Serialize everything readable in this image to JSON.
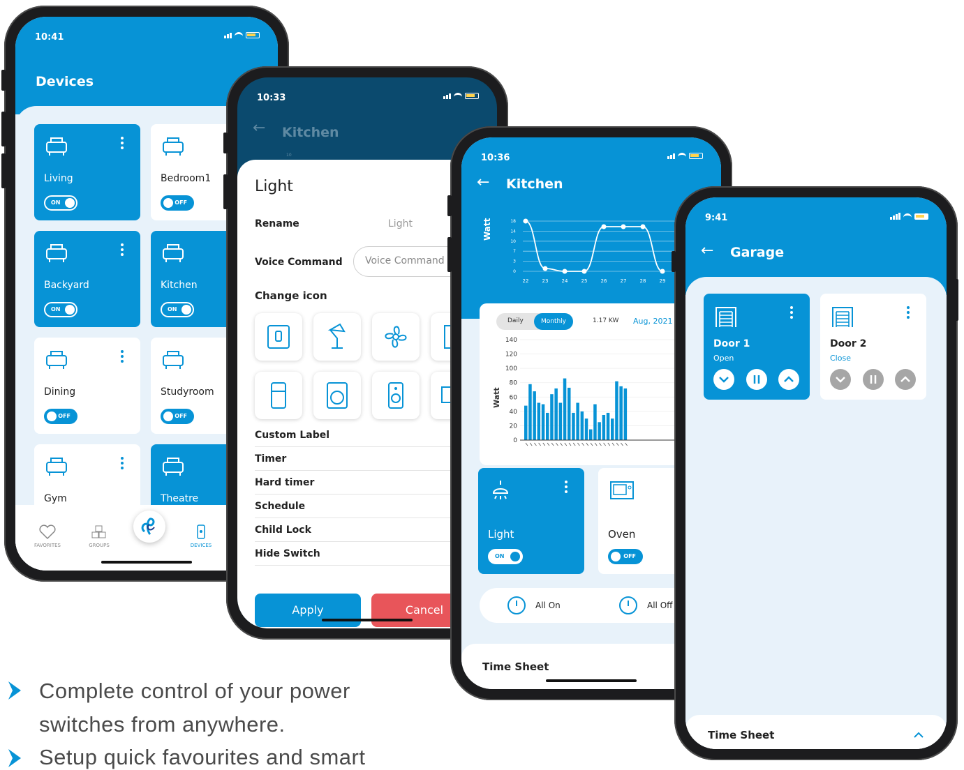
{
  "phone1": {
    "time": "10:41",
    "title": "Devices",
    "rooms": [
      {
        "name": "Living",
        "state": "ON",
        "icon": "sofa-icon"
      },
      {
        "name": "Bedroom1",
        "state": "OFF",
        "icon": "bed-icon"
      },
      {
        "name": "Backyard",
        "state": "ON",
        "icon": "house-icon"
      },
      {
        "name": "Kitchen",
        "state": "ON",
        "icon": "chef-hat-icon"
      },
      {
        "name": "Dining",
        "state": "OFF",
        "icon": "dining-table-icon"
      },
      {
        "name": "Studyroom",
        "state": "OFF",
        "icon": "desk-icon"
      },
      {
        "name": "Gym",
        "state": "",
        "icon": "exercise-bike-icon"
      },
      {
        "name": "Theatre",
        "state": "",
        "icon": "projector-icon"
      }
    ],
    "nav": {
      "favorites": "FAVORITES",
      "groups": "GROUPS",
      "devices": "DEVICES"
    }
  },
  "phone2": {
    "time": "10:33",
    "header": "Kitchen",
    "chart_tick": "10",
    "sheet_title": "Light",
    "rename_label": "Rename",
    "rename_value": "Light",
    "voice_label": "Voice Command",
    "voice_placeholder": "Voice Command",
    "change_icon": "Change icon",
    "rows": [
      "Custom Label",
      "Timer",
      "Hard timer",
      "Schedule",
      "Child Lock",
      "Hide Switch"
    ],
    "apply": "Apply",
    "cancel": "Cancel"
  },
  "phone3": {
    "time": "10:36",
    "header": "Kitchen",
    "line_ylabel": "Watt",
    "bar_ylabel": "Watt",
    "tab_daily": "Daily",
    "tab_monthly": "Monthly",
    "kw": "1.17 KW",
    "month": "Aug, 2021",
    "light": {
      "name": "Light",
      "state": "ON"
    },
    "oven": {
      "name": "Oven",
      "state": "OFF"
    },
    "all_on": "All On",
    "all_off": "All Off",
    "timesheet": "Time Sheet"
  },
  "phone4": {
    "time": "9:41",
    "header": "Garage",
    "door1": {
      "name": "Door 1",
      "status": "Open"
    },
    "door2": {
      "name": "Door 2",
      "status": "Close"
    },
    "timesheet": "Time Sheet"
  },
  "bullets": [
    "Complete control of your power",
    "switches from anywhere.",
    "Setup quick favourites and smart"
  ],
  "colors": {
    "primary": "#0793d6",
    "cancel": "#e8555a",
    "dark_header": "#0b4a6e"
  },
  "chart_data": [
    {
      "type": "line",
      "ylabel": "Watt",
      "x": [
        "22",
        "23",
        "24",
        "25",
        "26",
        "27",
        "28",
        "29"
      ],
      "yticks": [
        "18",
        "14",
        "10",
        "7",
        "3",
        "0"
      ],
      "values": [
        18,
        1,
        0,
        0,
        16,
        16,
        16,
        0
      ]
    },
    {
      "type": "bar",
      "ylabel": "Watt",
      "yticks": [
        "140",
        "120",
        "100",
        "80",
        "60",
        "40",
        "20",
        "0"
      ],
      "ylim": [
        0,
        140
      ],
      "values": [
        48,
        78,
        68,
        52,
        50,
        38,
        64,
        72,
        52,
        86,
        73,
        38,
        52,
        40,
        30,
        15,
        50,
        25,
        35,
        38,
        30,
        82,
        75,
        72
      ]
    }
  ]
}
